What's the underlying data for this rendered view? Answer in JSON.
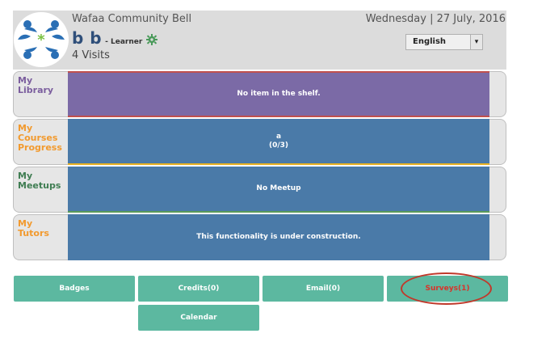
{
  "header": {
    "community": "Wafaa Community Bell",
    "date": "Wednesday | 27 July, 2016",
    "user_name": "b b",
    "role": "- Learner",
    "visits": "4 Visits",
    "language": "English"
  },
  "rows": [
    {
      "label": "My\nLibrary",
      "label_color": "#7b5e9e",
      "content": "No item in the shelf.",
      "bg": "#7b6aa6",
      "line": "#c0504d"
    },
    {
      "label": "My\nCourses\nProgress",
      "label_color": "#f29a2e",
      "content": "a\n(0/3)",
      "bg": "#4a7aa8",
      "line": "#e8b020"
    },
    {
      "label": "My\nMeetups",
      "label_color": "#3f7d52",
      "content": "No Meetup",
      "bg": "#4a7aa8",
      "line": "#5a9a5a"
    },
    {
      "label": "My\nTutors",
      "label_color": "#f29a2e",
      "content": "This functionality is under construction.",
      "bg": "#4a7aa8",
      "line": ""
    }
  ],
  "buttons": {
    "badges": "Badges",
    "credits": "Credits(0)",
    "email": "Email(0)",
    "surveys": "Surveys(1)",
    "calendar": "Calendar"
  },
  "colors": {
    "button_bg": "#5cb8a0",
    "highlight": "#c0392b"
  }
}
